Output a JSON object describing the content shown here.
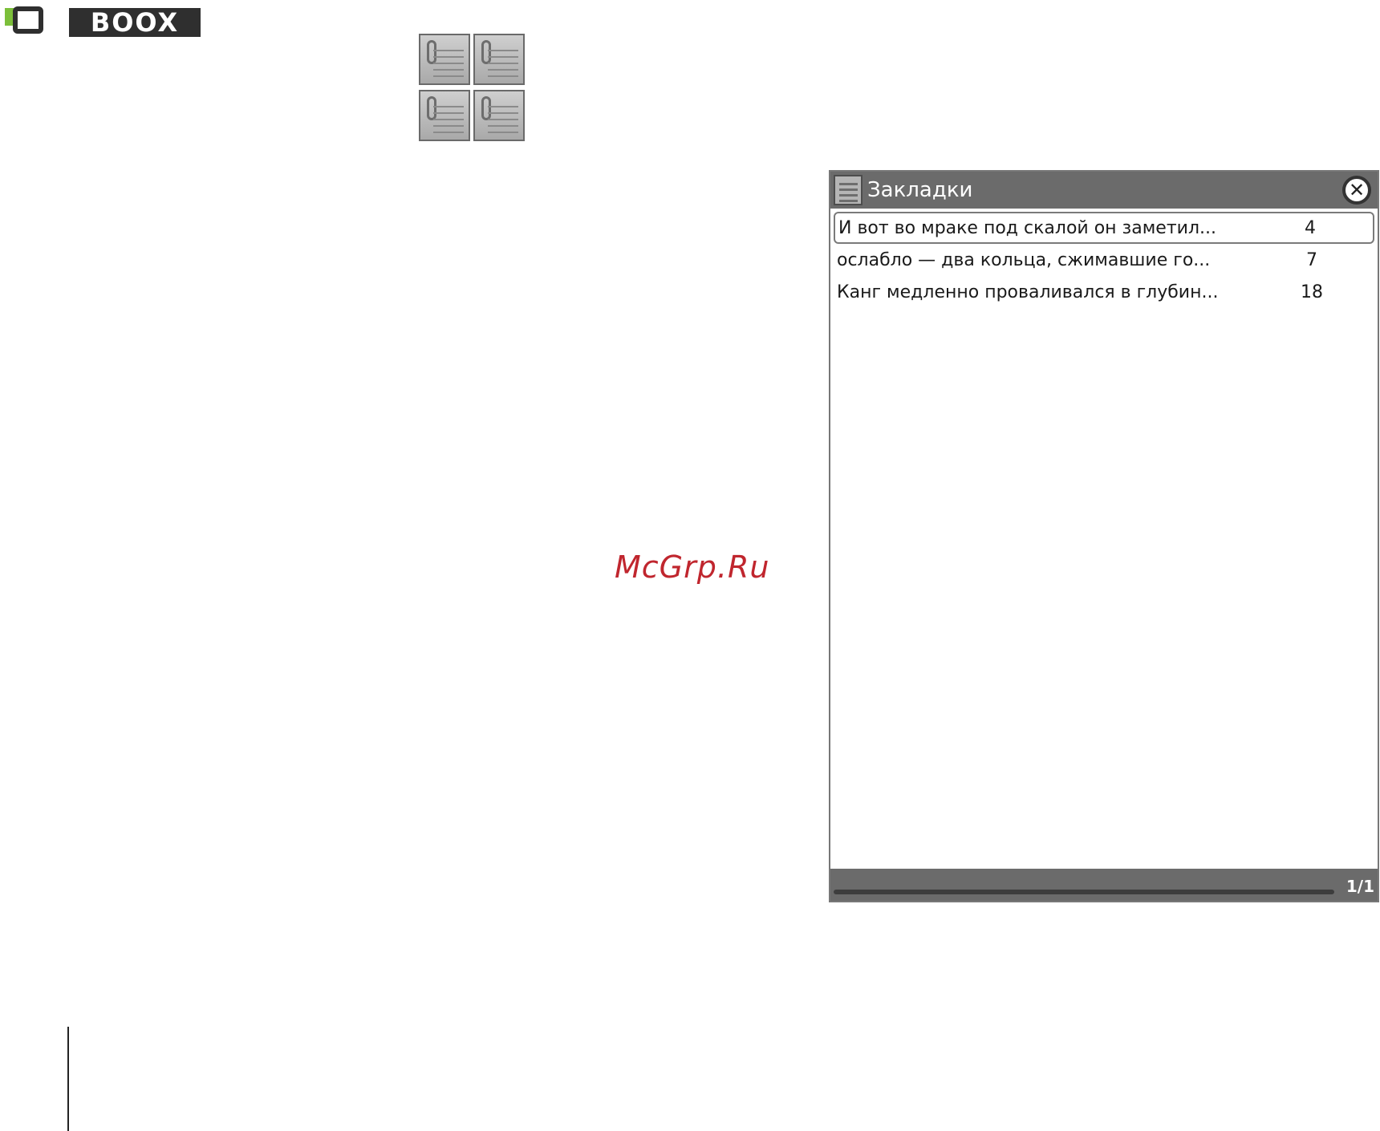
{
  "brand": {
    "wordmark": "BOOX",
    "accent_color": "#7cbf3a"
  },
  "watermark": "McGrp.Ru",
  "dialog": {
    "title": "Закладки",
    "close_icon": "close-icon",
    "bookmarks": [
      {
        "text": "И вот во мраке под скалой он заметил...",
        "page": "4",
        "selected": true
      },
      {
        "text": " ослабло — два кольца, сжимавшие го...",
        "page": "7",
        "selected": false
      },
      {
        "text": "Канг медленно проваливался в глубин...",
        "page": "18",
        "selected": false
      }
    ],
    "pagination": {
      "label": "1/1",
      "progress": 1.0
    }
  },
  "colors": {
    "titlebar": "#6b6b6b",
    "background": "#ffffff"
  }
}
